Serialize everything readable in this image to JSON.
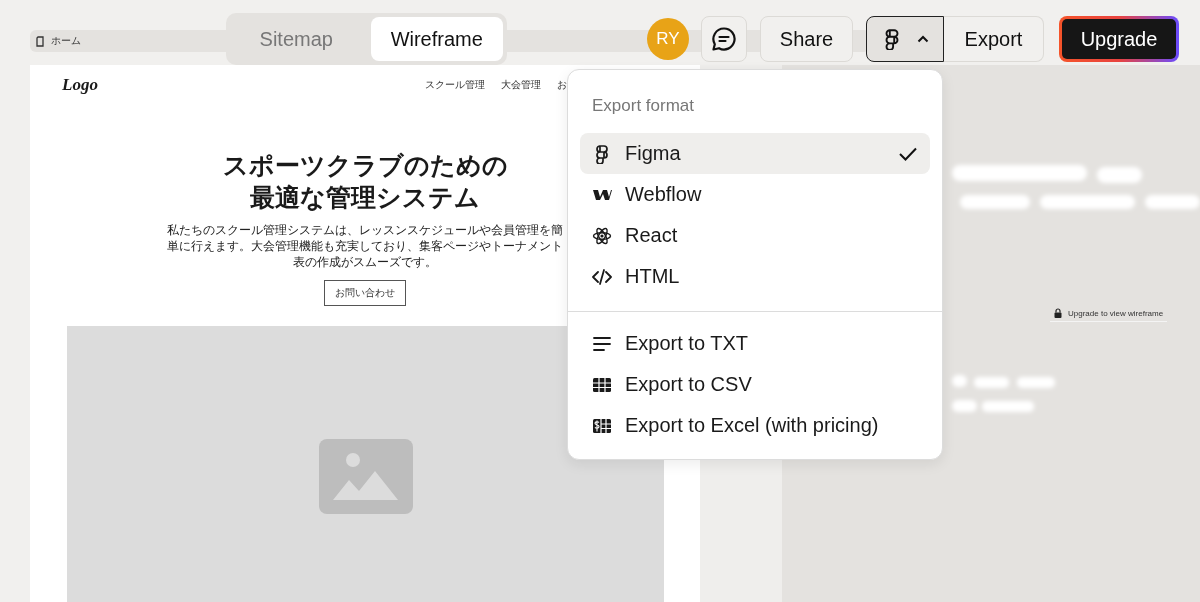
{
  "page_strip": {
    "label": "ホーム"
  },
  "view_tabs": [
    {
      "label": "Sitemap",
      "selected": false
    },
    {
      "label": "Wireframe",
      "selected": true
    }
  ],
  "toolbar": {
    "avatar": "RY",
    "share": "Share",
    "export_target": {
      "kind": "figma",
      "expanded": true
    },
    "export": "Export",
    "upgrade": "Upgrade"
  },
  "wireframe": {
    "logo": "Logo",
    "nav": [
      "スクール管理",
      "大会管理",
      "お"
    ],
    "title_lines": [
      "スポーツクラブのための",
      "最適な管理システム"
    ],
    "description": "私たちのスクール管理システムは、レッスンスケジュールや会員管理を簡単に行えます。大会管理機能も充実しており、集客ページやトーナメント表の作成がスムーズです。",
    "cta": "お問い合わせ"
  },
  "locked_preview": {
    "label": "Upgrade to view wireframe"
  },
  "export_menu": {
    "heading": "Export format",
    "formats": [
      {
        "label": "Figma",
        "kind": "figma",
        "selected": true
      },
      {
        "label": "Webflow",
        "kind": "webflow",
        "selected": false
      },
      {
        "label": "React",
        "kind": "react",
        "selected": false
      },
      {
        "label": "HTML",
        "kind": "html",
        "selected": false
      }
    ],
    "exports": [
      {
        "label": "Export to TXT",
        "kind": "txt"
      },
      {
        "label": "Export to CSV",
        "kind": "csv"
      },
      {
        "label": "Export to Excel (with pricing)",
        "kind": "excel"
      }
    ]
  }
}
